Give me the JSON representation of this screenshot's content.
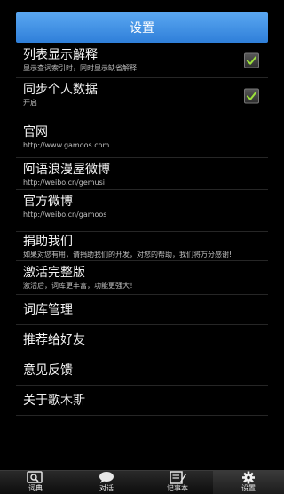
{
  "header": {
    "title": "设置"
  },
  "settings": [
    {
      "title": "列表显示解释",
      "subtitle": "显示查词索引时，同时显示缺省解释",
      "checked": true
    },
    {
      "title": "同步个人数据",
      "subtitle": "开启",
      "checked": true
    },
    {
      "title": "官网",
      "subtitle": "http://www.gamoos.com"
    },
    {
      "title": "阿语浪漫屋微博",
      "subtitle": "http://weibo.cn/gemusi"
    },
    {
      "title": "官方微博",
      "subtitle": "http://weibo.cn/gamoos"
    },
    {
      "title": "捐助我们",
      "subtitle": "如果对您有用，请捐助我们的开发，对您的帮助，我们将万分感谢!"
    },
    {
      "title": "激活完整版",
      "subtitle": "激活后，词库更丰富，功能更强大！"
    },
    {
      "title": "词库管理"
    },
    {
      "title": "推荐给好友"
    },
    {
      "title": "意见反馈"
    },
    {
      "title": "关于歌木斯"
    }
  ],
  "tabs": [
    {
      "label": "词典",
      "icon": "dictionary-icon"
    },
    {
      "label": "对话",
      "icon": "chat-bubble-icon"
    },
    {
      "label": "记事本",
      "icon": "notebook-icon"
    },
    {
      "label": "设置",
      "icon": "gear-icon",
      "active": true
    }
  ],
  "colors": {
    "header_top": "#5aa7f1",
    "header_bottom": "#2f7fd9",
    "check": "#9be03b",
    "background": "#000000"
  }
}
